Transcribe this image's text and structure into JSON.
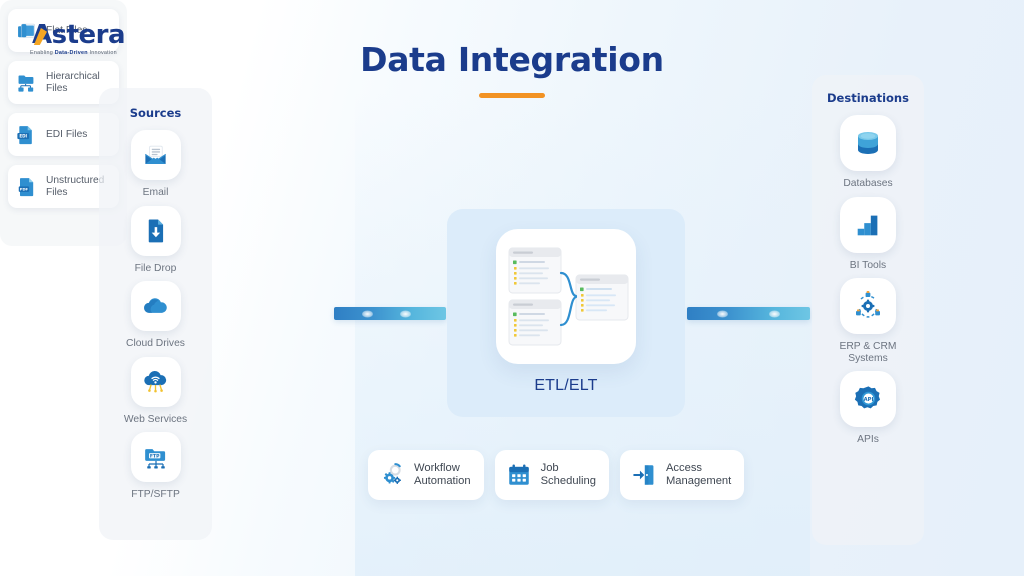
{
  "brand": {
    "name": "Astera",
    "tagline_prefix": "Enabling ",
    "tagline_bold": "Data-Driven",
    "tagline_suffix": " Innovation",
    "logo_blue": "#1b3c8c",
    "logo_orange": "#f5a623"
  },
  "header": {
    "title": "Data Integration",
    "accent_color": "#f29222"
  },
  "sources": {
    "title": "Sources",
    "items": [
      {
        "label": "Email",
        "icon": "envelope-icon"
      },
      {
        "label": "File Drop",
        "icon": "file-download-icon"
      },
      {
        "label": "Cloud Drives",
        "icon": "cloud-icon"
      },
      {
        "label": "Web Services",
        "icon": "cloud-wifi-icon"
      },
      {
        "label": "FTP/SFTP",
        "icon": "ftp-folder-icon"
      }
    ]
  },
  "file_types": {
    "items": [
      {
        "label": "Flat Files",
        "icon": "flat-files-icon"
      },
      {
        "label": "Hierarchical Files",
        "icon": "hierarchical-files-icon"
      },
      {
        "label": "EDI Files",
        "icon": "edi-files-icon",
        "badge": "EDI"
      },
      {
        "label": "Unstructured Files",
        "icon": "pdf-file-icon",
        "badge": "PDF"
      }
    ]
  },
  "center": {
    "etl_label": "ETL/ELT",
    "panel_color": "#dcecfa"
  },
  "connectors": {
    "left": {
      "name": "sources-to-etl-arrow",
      "gradient_from": "#2f7fc4",
      "gradient_to": "#6ec6e4"
    },
    "right": {
      "name": "etl-to-destinations-arrow",
      "gradient_from": "#2f7fc4",
      "gradient_to": "#6ec6e4"
    }
  },
  "features": {
    "items": [
      {
        "label_line1": "Workflow",
        "label_line2": "Automation",
        "icon": "gears-automation-icon"
      },
      {
        "label_line1": "Job",
        "label_line2": "Scheduling",
        "icon": "calendar-icon"
      },
      {
        "label_line1": "Access",
        "label_line2": "Management",
        "icon": "door-login-icon"
      }
    ]
  },
  "destinations": {
    "title": "Destinations",
    "items": [
      {
        "label": "Databases",
        "icon": "database-cylinder-icon"
      },
      {
        "label": "BI Tools",
        "icon": "bar-chart-icon"
      },
      {
        "label": "ERP & CRM Systems",
        "icon": "gear-network-icon"
      },
      {
        "label": "APIs",
        "icon": "api-gear-icon"
      }
    ]
  }
}
